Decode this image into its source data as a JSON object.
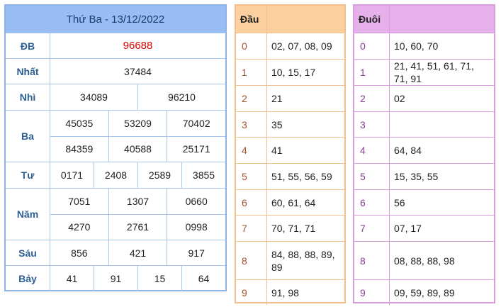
{
  "results": {
    "title": "Thứ Ba - 13/12/2022",
    "rows": [
      {
        "label": "ĐB",
        "lines": [
          [
            "96688"
          ]
        ],
        "special": true
      },
      {
        "label": "Nhất",
        "lines": [
          [
            "37484"
          ]
        ]
      },
      {
        "label": "Nhì",
        "lines": [
          [
            "34089",
            "96210"
          ]
        ]
      },
      {
        "label": "Ba",
        "lines": [
          [
            "45035",
            "53209",
            "70402"
          ],
          [
            "84359",
            "40588",
            "25171"
          ]
        ]
      },
      {
        "label": "Tư",
        "lines": [
          [
            "0171",
            "2408",
            "2589",
            "3855"
          ]
        ]
      },
      {
        "label": "Năm",
        "lines": [
          [
            "7051",
            "1307",
            "0660"
          ],
          [
            "4270",
            "2761",
            "0998"
          ]
        ]
      },
      {
        "label": "Sáu",
        "lines": [
          [
            "856",
            "421",
            "917"
          ]
        ]
      },
      {
        "label": "Bảy",
        "lines": [
          [
            "41",
            "91",
            "15",
            "64"
          ]
        ]
      }
    ]
  },
  "dau": {
    "header": "Đầu",
    "rows": [
      {
        "key": "0",
        "value": "02, 07, 08, 09"
      },
      {
        "key": "1",
        "value": "10, 15, 17"
      },
      {
        "key": "2",
        "value": "21"
      },
      {
        "key": "3",
        "value": "35"
      },
      {
        "key": "4",
        "value": "41"
      },
      {
        "key": "5",
        "value": "51, 55, 56, 59"
      },
      {
        "key": "6",
        "value": "60, 61, 64"
      },
      {
        "key": "7",
        "value": "70, 71, 71"
      },
      {
        "key": "8",
        "value": "84, 88, 88, 89, 89"
      },
      {
        "key": "9",
        "value": "91, 98"
      }
    ]
  },
  "duoi": {
    "header": "Đuôi",
    "rows": [
      {
        "key": "0",
        "value": "10, 60, 70"
      },
      {
        "key": "1",
        "value": "21, 41, 51, 61, 71, 71, 91"
      },
      {
        "key": "2",
        "value": "02"
      },
      {
        "key": "3",
        "value": ""
      },
      {
        "key": "4",
        "value": "64, 84"
      },
      {
        "key": "5",
        "value": "15, 35, 55"
      },
      {
        "key": "6",
        "value": "56"
      },
      {
        "key": "7",
        "value": "07, 17"
      },
      {
        "key": "8",
        "value": "08, 88, 88, 98"
      },
      {
        "key": "9",
        "value": "09, 59, 89, 89"
      }
    ]
  },
  "colors": {
    "results_header": "#97bdf3",
    "special_prize": "#e00000",
    "dau_header": "#fbcf9e",
    "duoi_header": "#e6b0ea"
  }
}
